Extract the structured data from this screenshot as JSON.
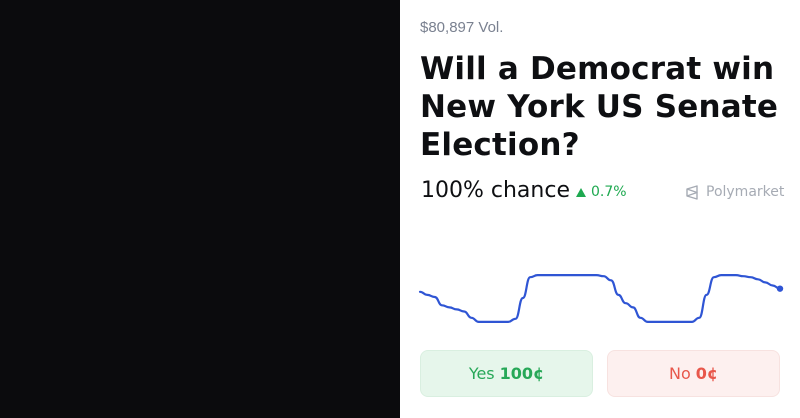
{
  "market": {
    "volume": "$80,897 Vol.",
    "question": "Will a Democrat win New York US Senate Election?",
    "chance": "100% chance",
    "change": "0.7%",
    "change_direction": "up",
    "brand": "Polymarket"
  },
  "outcomes": {
    "yes_label": "Yes",
    "yes_price": "100¢",
    "no_label": "No",
    "no_price": "0¢"
  },
  "icons": {
    "change": "triangle-up-icon",
    "brand": "polymarket-logo-icon"
  },
  "colors": {
    "line": "#2f55d4",
    "positive": "#1ea950",
    "negative": "#e8574b",
    "yes_bg": "#e6f6eb",
    "no_bg": "#fdf0ef"
  },
  "chart_data": {
    "type": "line",
    "series": [
      {
        "values": [
          0.81,
          0.78,
          0.76,
          0.68,
          0.66,
          0.64,
          0.62,
          0.56,
          0.52,
          0.52,
          0.52,
          0.52,
          0.52,
          0.55,
          0.75,
          0.95,
          0.97,
          0.97,
          0.97,
          0.97,
          0.97,
          0.97,
          0.97,
          0.97,
          0.97,
          0.96,
          0.92,
          0.78,
          0.7,
          0.66,
          0.56,
          0.52,
          0.52,
          0.52,
          0.52,
          0.52,
          0.52,
          0.52,
          0.56,
          0.78,
          0.95,
          0.97,
          0.97,
          0.97,
          0.96,
          0.95,
          0.93,
          0.9,
          0.87,
          0.84
        ]
      }
    ]
  }
}
